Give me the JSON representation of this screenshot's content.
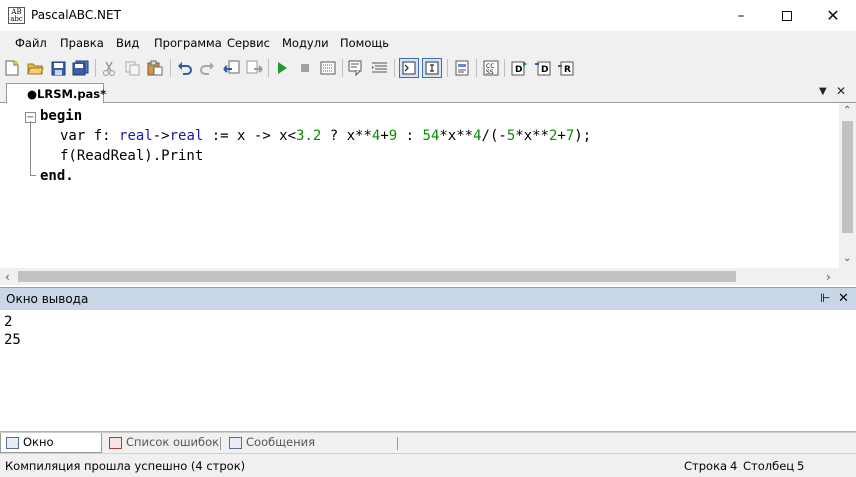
{
  "window": {
    "title": "PascalABC.NET",
    "icon_text": "AB\nabc"
  },
  "menu": [
    "Файл",
    "Правка",
    "Вид",
    "Программа",
    "Сервис",
    "Модули",
    "Помощь"
  ],
  "tabs": {
    "active": "●LRSM.pas*"
  },
  "editor": {
    "line1": "begin",
    "line2": {
      "kw1": "var",
      "p1": " f: ",
      "ty1": "real",
      "p2": "->",
      "ty2": "real",
      "p3": " := x -> x<",
      "n1": "3.2",
      "p4": " ? x**",
      "n2": "4",
      "p5": "+",
      "n3": "9",
      "p6": " : ",
      "n4": "54",
      "p7": "*x**",
      "n5": "4",
      "p8": "/(-",
      "n6": "5",
      "p9": "*x**",
      "n7": "2",
      "p10": "+",
      "n8": "7",
      "p11": ");"
    },
    "line3": "f(ReadReal).Print",
    "line4": "end."
  },
  "output_panel": {
    "title": "Окно вывода",
    "lines": [
      "2",
      "25"
    ]
  },
  "bottom_tabs": [
    "Окно вывода",
    "Список ошибок",
    "Сообщения компилятора"
  ],
  "status": {
    "message": "Компиляция прошла успешно (4 строк)",
    "row_label": "Строка",
    "row_value": "4",
    "col_label": "Столбец",
    "col_value": "5"
  },
  "colors": {
    "keyword": "#000000",
    "type": "#1a1aa6",
    "number": "#0a8c00",
    "output_header": "#c9d6e8"
  }
}
